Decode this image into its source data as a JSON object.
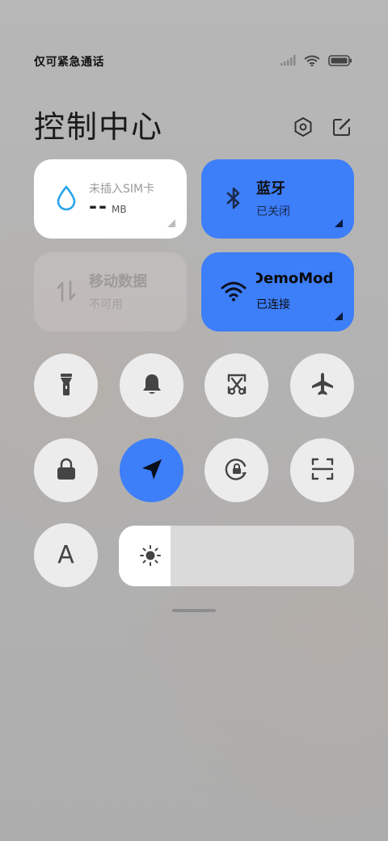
{
  "status_bar": {
    "carrier_text": "仅可紧急通话",
    "icons": [
      "signal-icon",
      "wifi-icon",
      "battery-icon"
    ]
  },
  "header": {
    "title": "控制中心",
    "actions": [
      "settings-icon",
      "edit-icon"
    ]
  },
  "cards": {
    "sim": {
      "label": "未插入SIM卡",
      "value": "--",
      "unit": "MB",
      "icon": "water-drop-icon"
    },
    "bluetooth": {
      "title": "蓝牙",
      "status": "已关闭",
      "icon": "bluetooth-icon"
    },
    "mobile_data": {
      "title": "移动数据",
      "status": "不可用",
      "icon": "data-transfer-icon"
    },
    "wifi": {
      "title": "DemoMod",
      "status": "已连接",
      "icon": "wifi-icon"
    }
  },
  "toggles": [
    {
      "name": "flashlight",
      "icon": "flashlight-icon",
      "active": false
    },
    {
      "name": "ringer",
      "icon": "bell-icon",
      "active": false
    },
    {
      "name": "screenshot",
      "icon": "scissors-screenshot-icon",
      "active": false
    },
    {
      "name": "airplane-mode",
      "icon": "airplane-icon",
      "active": false
    },
    {
      "name": "screen-lock",
      "icon": "lock-icon",
      "active": false
    },
    {
      "name": "location",
      "icon": "location-arrow-icon",
      "active": true
    },
    {
      "name": "rotation-lock",
      "icon": "rotation-lock-icon",
      "active": false
    },
    {
      "name": "scanner",
      "icon": "scan-icon",
      "active": false
    }
  ],
  "font_toggle": {
    "label": "A",
    "icon": "font-icon"
  },
  "brightness": {
    "icon": "sun-icon",
    "level": 0.22
  },
  "colors": {
    "accent": "#3d7ef9",
    "background": "#b4b4b4",
    "tile": "#ececec"
  }
}
